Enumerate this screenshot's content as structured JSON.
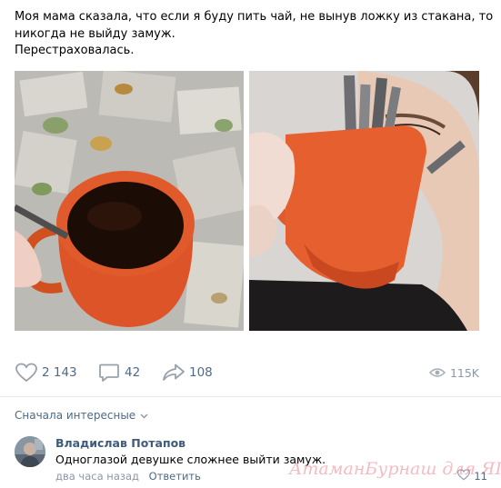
{
  "post": {
    "text_lines": [
      "Моя мама сказала, что если я буду пить чай, не вынув ложку из стакана, то",
      "никогда не выйду замуж.",
      "Перестраховалась."
    ]
  },
  "actions": {
    "likes": "2 143",
    "comments": "42",
    "shares": "108",
    "views": "115K"
  },
  "comments_section": {
    "sort_label": "Сначала интересные",
    "items": [
      {
        "author": "Владислав Потапов",
        "text": "Одноглазой девушке сложнее выйти замуж.",
        "time": "два часа назад",
        "reply_label": "Ответить",
        "likes": "11"
      }
    ]
  },
  "watermark": "АтаманБурнаш для ЯП",
  "colors": {
    "link": "#4f6a85",
    "author": "#3e5b7c",
    "icon": "#99a2ad",
    "mug": "#e2572d"
  },
  "icons": {
    "like": "heart-icon",
    "comment": "speech-bubble-icon",
    "share": "share-arrow-icon",
    "views": "eye-icon",
    "sort": "chevron-down-icon"
  }
}
